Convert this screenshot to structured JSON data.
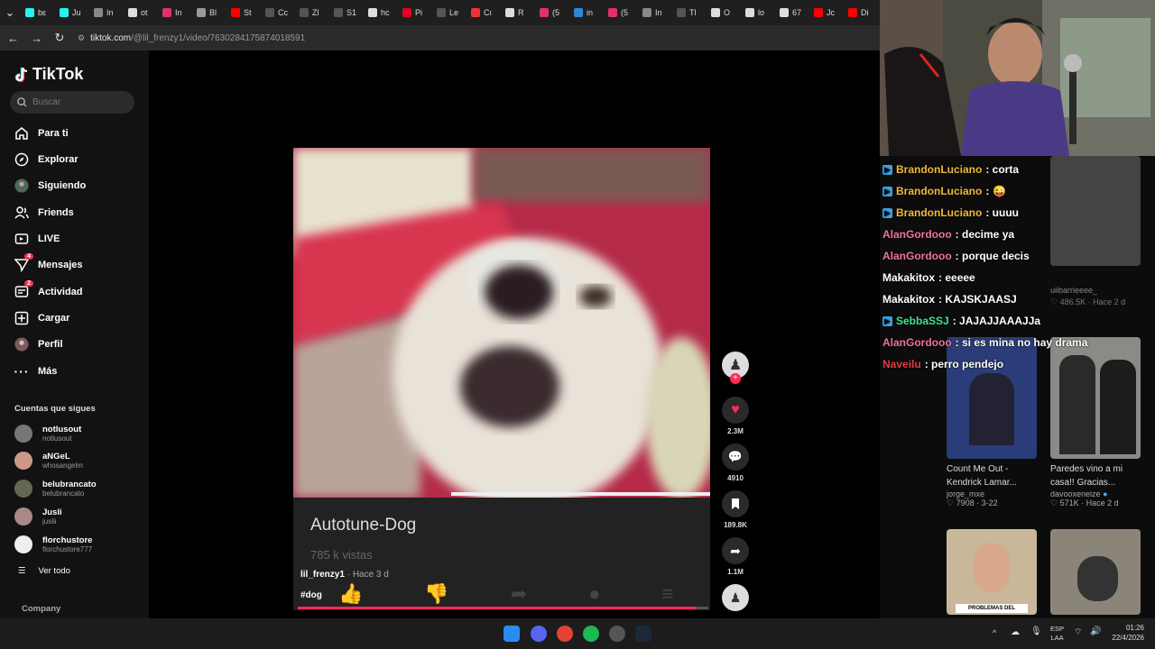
{
  "browser": {
    "tabs": [
      {
        "label": "bε",
        "color": "#25f4ee"
      },
      {
        "label": "Ju",
        "color": "#25f4ee"
      },
      {
        "label": "In",
        "color": "#888"
      },
      {
        "label": "ot",
        "color": "#ddd"
      },
      {
        "label": "In",
        "color": "#e1306c"
      },
      {
        "label": "Bl",
        "color": "#999"
      },
      {
        "label": "St",
        "color": "#ff0000"
      },
      {
        "label": "Cc",
        "color": "#555"
      },
      {
        "label": "Zl",
        "color": "#555"
      },
      {
        "label": "S1",
        "color": "#555"
      },
      {
        "label": "hc",
        "color": "#ddd"
      },
      {
        "label": "Pi",
        "color": "#e60023"
      },
      {
        "label": "Le",
        "color": "#555"
      },
      {
        "label": "Cı",
        "color": "#e33"
      },
      {
        "label": "R",
        "color": "#ddd"
      },
      {
        "label": "(5",
        "color": "#e1306c"
      },
      {
        "label": "in",
        "color": "#2b88d8"
      },
      {
        "label": "(5",
        "color": "#e1306c"
      },
      {
        "label": "In",
        "color": "#888"
      },
      {
        "label": "Tl",
        "color": "#555"
      },
      {
        "label": "O",
        "color": "#ddd"
      },
      {
        "label": "lo",
        "color": "#ddd"
      },
      {
        "label": "67",
        "color": "#ddd"
      },
      {
        "label": "Jc",
        "color": "#ff0000"
      },
      {
        "label": "Di",
        "color": "#ff0000"
      }
    ],
    "url_host": "tiktok.com",
    "url_path": "/@lil_frenzy1/video/7630284175874018591"
  },
  "sidebar": {
    "logo": "TikTok",
    "search_placeholder": "Buscar",
    "nav": [
      {
        "label": "Para ti",
        "icon": "home-icon",
        "badge": ""
      },
      {
        "label": "Explorar",
        "icon": "compass-icon",
        "badge": ""
      },
      {
        "label": "Siguiendo",
        "icon": "following-avatar-icon",
        "badge": ""
      },
      {
        "label": "Friends",
        "icon": "friends-icon",
        "badge": ""
      },
      {
        "label": "LIVE",
        "icon": "live-icon",
        "badge": ""
      },
      {
        "label": "Mensajes",
        "icon": "messages-icon",
        "badge": "4"
      },
      {
        "label": "Actividad",
        "icon": "activity-icon",
        "badge": "2"
      },
      {
        "label": "Cargar",
        "icon": "upload-icon",
        "badge": ""
      },
      {
        "label": "Perfil",
        "icon": "profile-icon",
        "badge": ""
      },
      {
        "label": "Más",
        "icon": "more-icon",
        "badge": ""
      }
    ],
    "following_heading": "Cuentas que sigues",
    "accounts": [
      {
        "name": "notlusout",
        "handle": "notlusout",
        "color": "#777"
      },
      {
        "name": "aNGeL",
        "handle": "whosangelm",
        "color": "#c98"
      },
      {
        "name": "belubrancato",
        "handle": "belubrancato",
        "color": "#665"
      },
      {
        "name": "Jusli",
        "handle": "juslii",
        "color": "#a88"
      },
      {
        "name": "florchustore",
        "handle": "florchustore777",
        "color": "#eee"
      }
    ],
    "see_all": "Ver todo",
    "company": "Company"
  },
  "video": {
    "overlay_title": "Autotune-Dog",
    "overlay_views": "785 k vistas",
    "author": "lil_frenzy1",
    "ago": "Hace 3 d",
    "hashtag": "#dog",
    "progress": 0.97
  },
  "actions": {
    "likes": "2.3M",
    "comments": "4910",
    "saves": "189.8K",
    "shares": "1.1M"
  },
  "chat": [
    {
      "user": "BrandonLuciano",
      "msg": ": corta",
      "color": "#f0b93c",
      "badge": true
    },
    {
      "user": "BrandonLuciano",
      "msg": ":",
      "color": "#f0b93c",
      "badge": true
    },
    {
      "user": "BrandonLuciano",
      "msg": ": uuuu",
      "color": "#f0b93c",
      "badge": true
    },
    {
      "user": "AlanGordooo",
      "msg": ": decime ya",
      "color": "#f0739c",
      "badge": false
    },
    {
      "user": "AlanGordooo",
      "msg": ": porque decis",
      "color": "#f0739c",
      "badge": false
    },
    {
      "user": "Makakitox",
      "msg": ": eeeee",
      "color": "#ffffff",
      "badge": false
    },
    {
      "user": "Makakitox",
      "msg": ": KAJSKJAASJ",
      "color": "#ffffff",
      "badge": false
    },
    {
      "user": "SebbaSSJ",
      "msg": ": JAJAJJAAAJJa",
      "color": "#3ce68c",
      "badge": true
    },
    {
      "user": "AlanGordooo",
      "msg": ": si es mina no hay drama",
      "color": "#f0739c",
      "badge": false
    },
    {
      "user": "Naveilu",
      "msg": ": perro pendejo",
      "color": "#e23c3c",
      "badge": false
    }
  ],
  "suggested": {
    "top_right": {
      "author": "uiibarrieeee_",
      "likes": "486.5K",
      "ago": "Hace 2 d"
    },
    "cards": [
      {
        "title1": "Count Me Out -",
        "title2": "Kendrick Lamar...",
        "author": "jorge_mxe",
        "likes": "7908",
        "ago": "3-22"
      },
      {
        "title1": "Paredes vino a mi",
        "title2": "casa!! Gracias...",
        "author": "davooxeneize",
        "likes": "571K",
        "ago": "Hace 2 d"
      }
    ],
    "bottom_thumb_text": "PROBLEMAS DEL"
  },
  "taskbar": {
    "lang": "ESP",
    "lang2": "LAA",
    "time": "01:26",
    "date": "22/4/2026"
  }
}
